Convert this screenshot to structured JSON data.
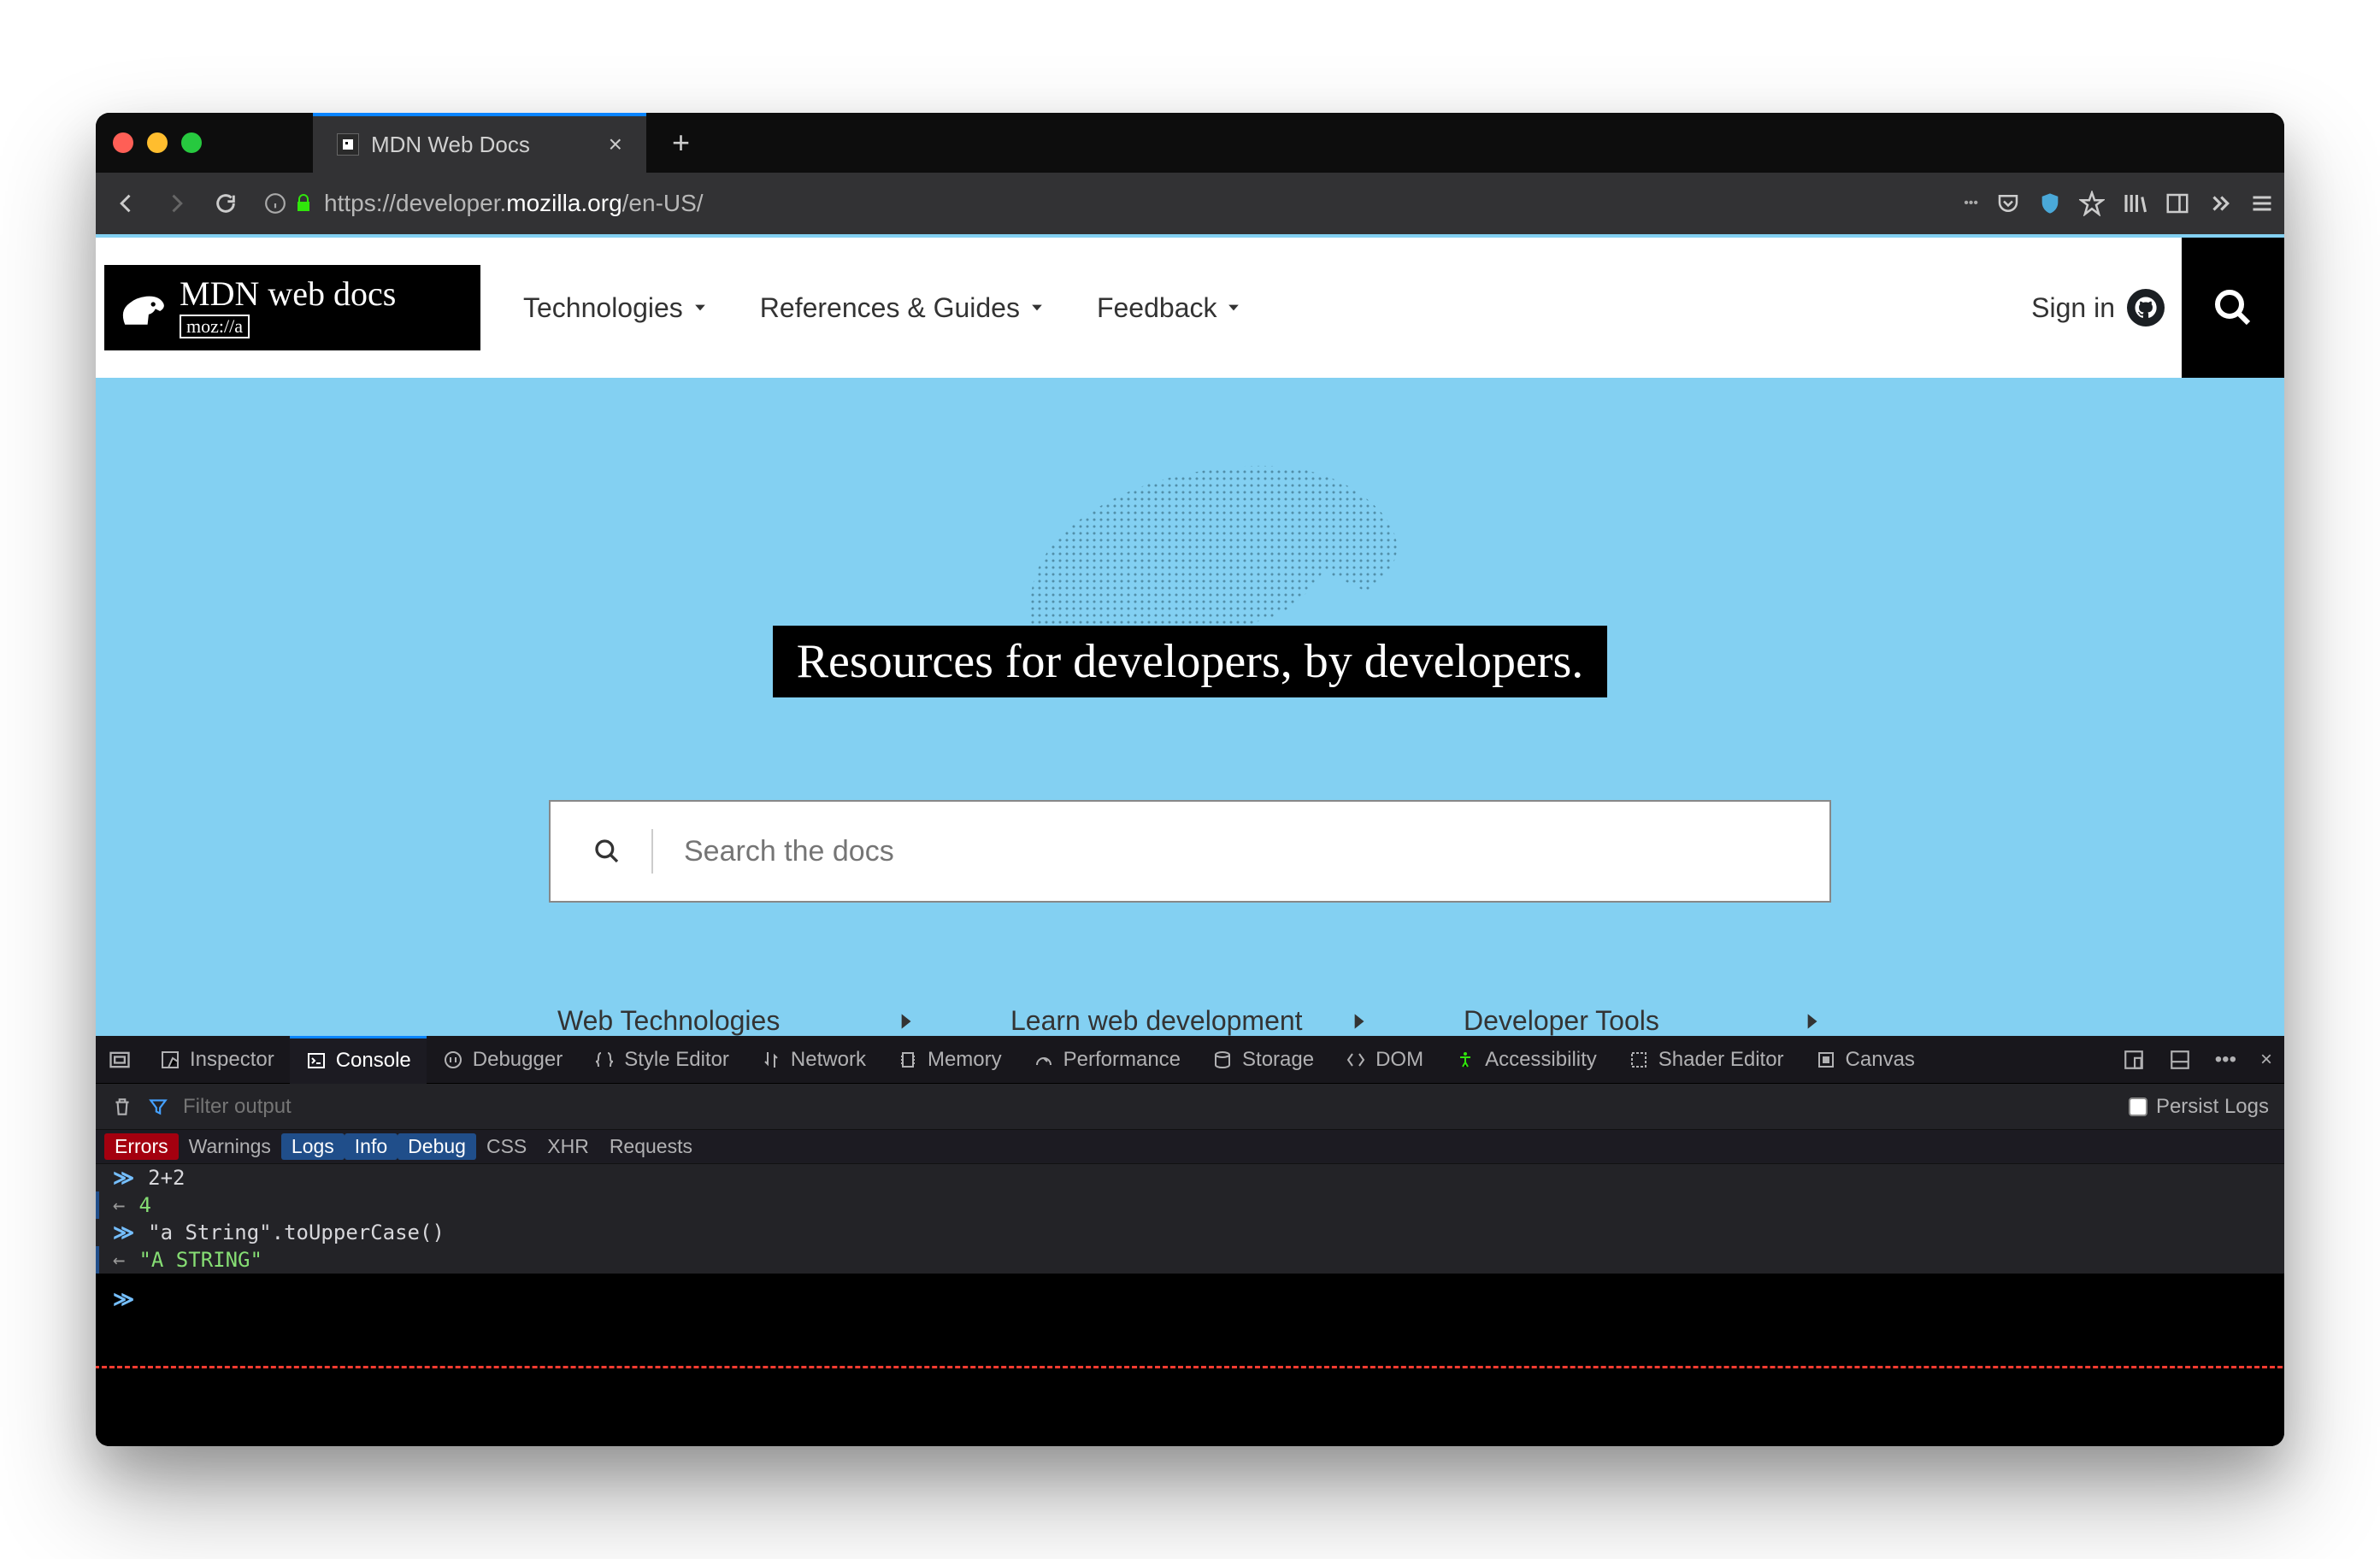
{
  "browser": {
    "tab_title": "MDN Web Docs",
    "url_prefix": "https://",
    "url_mid": "developer.",
    "url_domain": "mozilla.org",
    "url_path": "/en-US/"
  },
  "header": {
    "logo_top": "MDN web docs",
    "logo_bottom": "moz://a",
    "nav": [
      "Technologies",
      "References & Guides",
      "Feedback"
    ],
    "signin": "Sign in"
  },
  "hero": {
    "title": "Resources for developers, by developers.",
    "search_placeholder": "Search the docs",
    "quicklinks": [
      "Web Technologies",
      "Learn web development",
      "Developer Tools"
    ]
  },
  "devtools": {
    "tabs": [
      "Inspector",
      "Console",
      "Debugger",
      "Style Editor",
      "Network",
      "Memory",
      "Performance",
      "Storage",
      "DOM",
      "Accessibility",
      "Shader Editor",
      "Canvas"
    ],
    "active_tab": "Console",
    "filter_placeholder": "Filter output",
    "persist_label": "Persist Logs",
    "chips": [
      "Errors",
      "Warnings",
      "Logs",
      "Info",
      "Debug",
      "CSS",
      "XHR",
      "Requests"
    ],
    "chips_on": [
      "Errors",
      "Logs",
      "Info",
      "Debug"
    ],
    "lines": [
      {
        "type": "in",
        "text": "2+2"
      },
      {
        "type": "out",
        "text": "4",
        "cls": "num"
      },
      {
        "type": "in",
        "text": "\"a String\".toUpperCase()"
      },
      {
        "type": "out",
        "text": "\"A STRING\"",
        "cls": "str"
      }
    ]
  }
}
